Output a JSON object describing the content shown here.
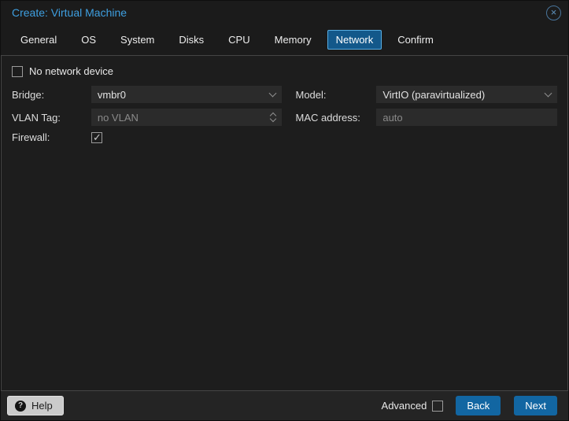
{
  "window": {
    "title": "Create: Virtual Machine",
    "close_icon": "circle-x"
  },
  "tabs": {
    "active": "Network",
    "items": [
      {
        "label": "General"
      },
      {
        "label": "OS"
      },
      {
        "label": "System"
      },
      {
        "label": "Disks"
      },
      {
        "label": "CPU"
      },
      {
        "label": "Memory"
      },
      {
        "label": "Network"
      },
      {
        "label": "Confirm"
      }
    ]
  },
  "form": {
    "no_network_device": {
      "label": "No network device",
      "checked": false
    },
    "bridge": {
      "label": "Bridge:",
      "value": "vmbr0",
      "control": "dropdown"
    },
    "model": {
      "label": "Model:",
      "value": "VirtIO (paravirtualized)",
      "control": "dropdown"
    },
    "vlan_tag": {
      "label": "VLAN Tag:",
      "placeholder": "no VLAN",
      "disabled": true,
      "control": "number-spinner"
    },
    "mac_address": {
      "label": "MAC address:",
      "placeholder": "auto",
      "value": ""
    },
    "firewall": {
      "label": "Firewall:",
      "checked": true
    }
  },
  "footer": {
    "help_label": "Help",
    "help_icon": "question-circle",
    "advanced": {
      "label": "Advanced",
      "checked": false
    },
    "back_label": "Back",
    "next_label": "Next"
  },
  "colors": {
    "title_blue": "#3e9fe0",
    "active_tab_bg": "#13588a",
    "active_tab_border": "#58ade2",
    "button_blue": "#1266a2",
    "panel_border": "#454545",
    "field_bg": "#2b2b2b",
    "placeholder_gray": "#8a8a8a"
  }
}
